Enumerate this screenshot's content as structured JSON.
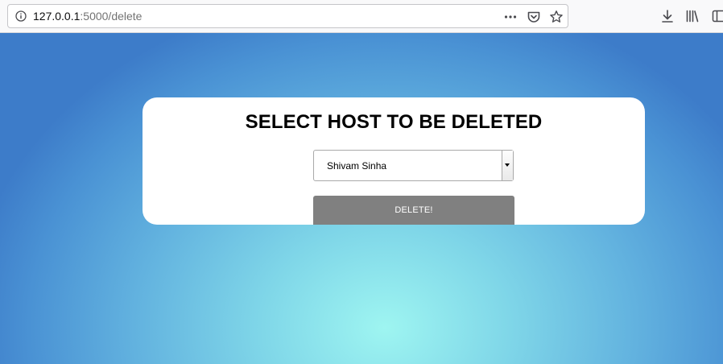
{
  "browser": {
    "url_host": "127.0.0.1",
    "url_rest": ":5000/delete",
    "icons": {
      "site_info": "info-icon",
      "page_actions": "more-horizontal-icon",
      "pocket": "pocket-icon",
      "bookmark": "star-icon",
      "downloads": "download-icon",
      "library": "library-icon",
      "sidebar": "sidebar-icon"
    }
  },
  "page": {
    "title": "SELECT HOST TO BE DELETED",
    "host_select": {
      "selected": "Shivam Sinha"
    },
    "delete_button": "DELETE!",
    "colors": {
      "button_bg": "#808080",
      "gradient_center": "#9ef5f1",
      "gradient_edge": "#3d7cc9"
    }
  }
}
